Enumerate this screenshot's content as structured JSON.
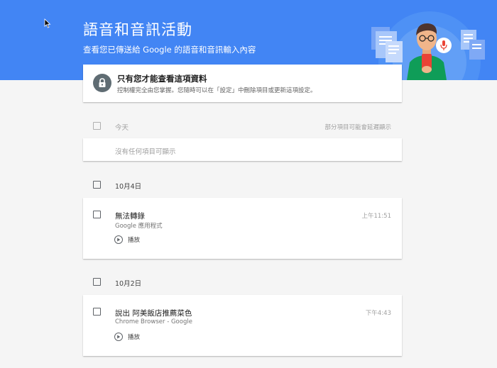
{
  "header": {
    "title": "語音和音訊活動",
    "subtitle": "查看您已傳送給 Google 的語音和音訊輸入內容"
  },
  "privacy": {
    "title": "只有您才能查看這項資料",
    "description": "控制權完全由您掌握。您隨時可以在「設定」中刪除項目或更新這項設定。"
  },
  "today": {
    "label": "今天",
    "note": "部分項目可能會延遲顯示",
    "empty": "沒有任何項目可顯示"
  },
  "groups": [
    {
      "date": "10月4日",
      "item": {
        "title": "無法轉錄",
        "source": "Google 應用程式",
        "time": "上午11:51",
        "play_label": "播放"
      }
    },
    {
      "date": "10月2日",
      "item": {
        "title": "說出 阿美飯店推薦菜色",
        "source": "Chrome Browser - Google",
        "time": "下午4:43",
        "play_label": "播放"
      }
    }
  ],
  "colors": {
    "header_bg": "#4285f4",
    "page_bg": "#f5f5f5",
    "mic_red": "#ea4335"
  },
  "icons": [
    "cursor-icon",
    "lock-icon",
    "play-icon",
    "mic-icon"
  ]
}
